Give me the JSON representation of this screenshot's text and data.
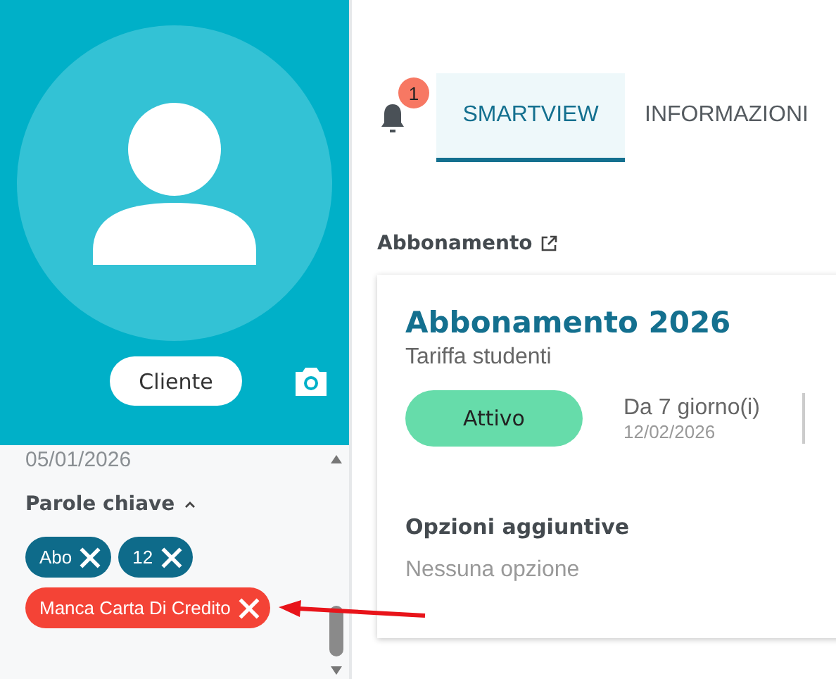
{
  "profile": {
    "role_button": "Cliente"
  },
  "details": {
    "date": "05/01/2026",
    "keywords": {
      "title": "Parole chiave",
      "expanded": true,
      "tags": [
        {
          "label": "Abo",
          "color": "#0e6b8a"
        },
        {
          "label": "12",
          "color": "#0e6b8a"
        },
        {
          "label": "Manca Carta Di Credito",
          "color": "#f44336"
        }
      ]
    }
  },
  "notifications": {
    "count": "1"
  },
  "tabs": [
    {
      "label": "SMARTVIEW",
      "selected": true
    },
    {
      "label": "INFORMAZIONI",
      "selected": false
    }
  ],
  "section": {
    "title": "Abbonamento"
  },
  "subscription": {
    "name": "Abbonamento 2026",
    "tariff": "Tariffa studenti",
    "status": "Attivo",
    "since": "Da 7 giorno(i)",
    "start_date": "12/02/2026",
    "options_title": "Opzioni aggiuntive",
    "options_empty": "Nessuna opzione"
  }
}
